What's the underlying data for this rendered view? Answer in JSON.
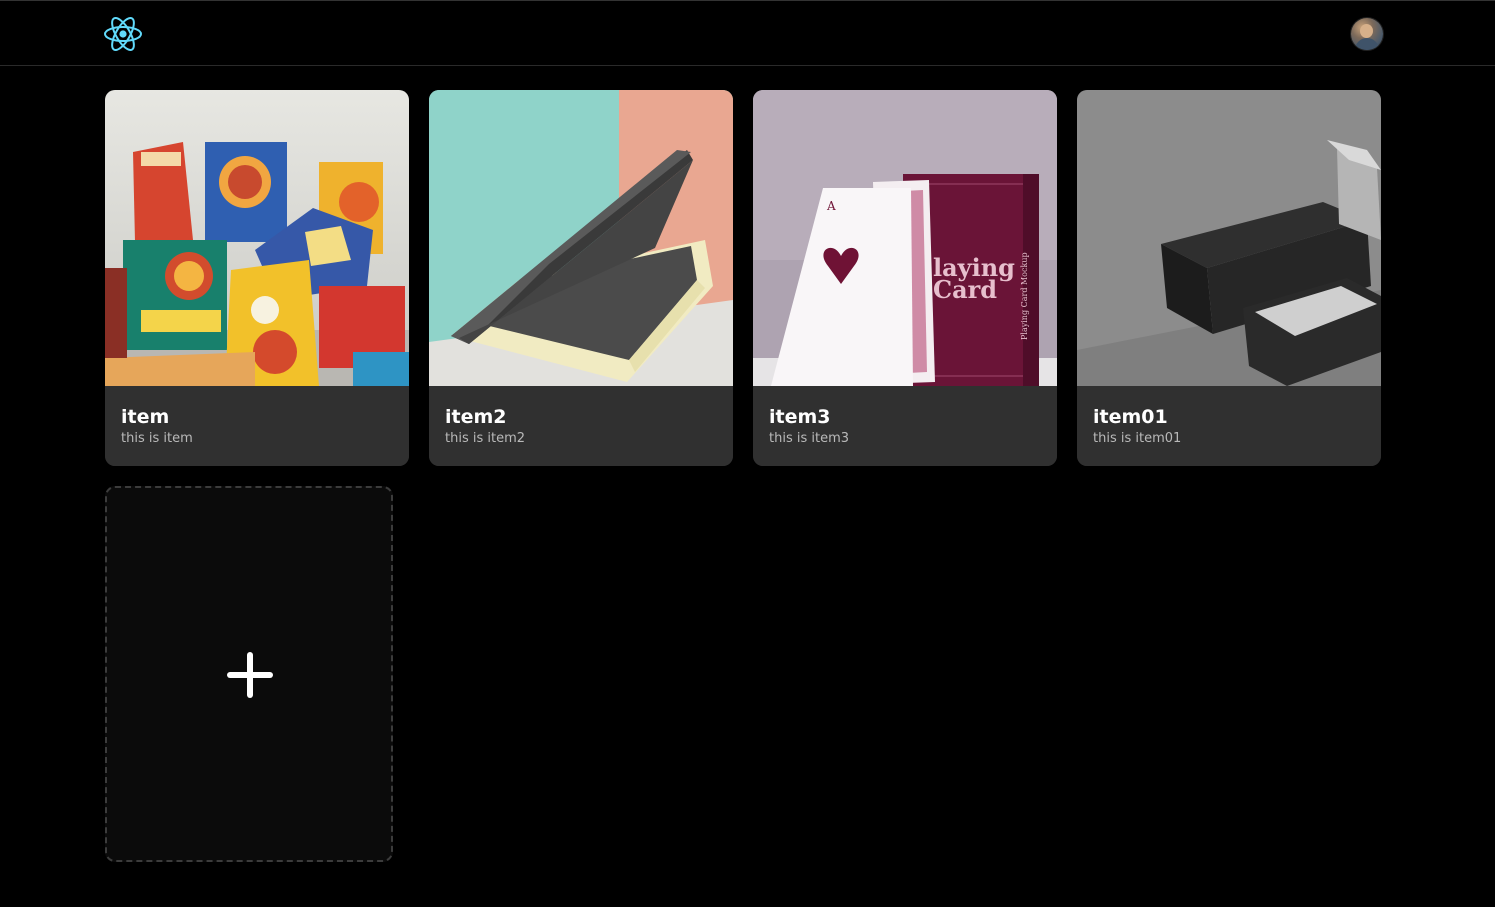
{
  "header": {
    "logo_icon": "react-atom-icon",
    "accent_color": "#61dafb",
    "avatar_icon": "user-avatar"
  },
  "items": [
    {
      "title": "item",
      "subtitle": "this is item"
    },
    {
      "title": "item2",
      "subtitle": "this is item2"
    },
    {
      "title": "item3",
      "subtitle": "this is item3",
      "image_text": [
        "laying",
        "Card",
        "Playing Card Mockup"
      ]
    },
    {
      "title": "item01",
      "subtitle": "this is item01"
    }
  ],
  "add_card": {
    "icon": "plus-icon"
  }
}
